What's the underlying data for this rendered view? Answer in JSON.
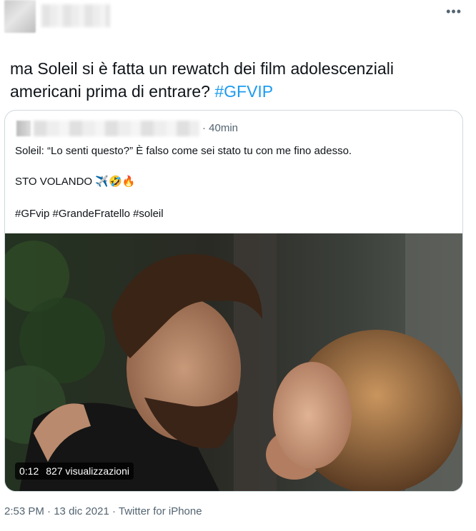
{
  "tweet": {
    "text_line1": "ma Soleil si è fatta un rewatch dei film adolescenziali",
    "text_line2": "americani prima di entrare? ",
    "hashtag": "#GFVIP",
    "more_label": "•••"
  },
  "quote": {
    "time": "· 40min",
    "line1": "Soleil: “Lo senti questo?” È falso come sei stato tu con me fino adesso.",
    "line2_text": "STO VOLANDO ",
    "line2_emojis": "✈️🤣🔥",
    "hashtags": "#GFvip #GrandeFratello #soleil",
    "video_duration": "0:12",
    "video_views": "827 visualizzazioni"
  },
  "meta": {
    "time": "2:53 PM",
    "sep1": " · ",
    "date": "13 dic 2021",
    "sep2": " · ",
    "source": "Twitter for iPhone"
  }
}
